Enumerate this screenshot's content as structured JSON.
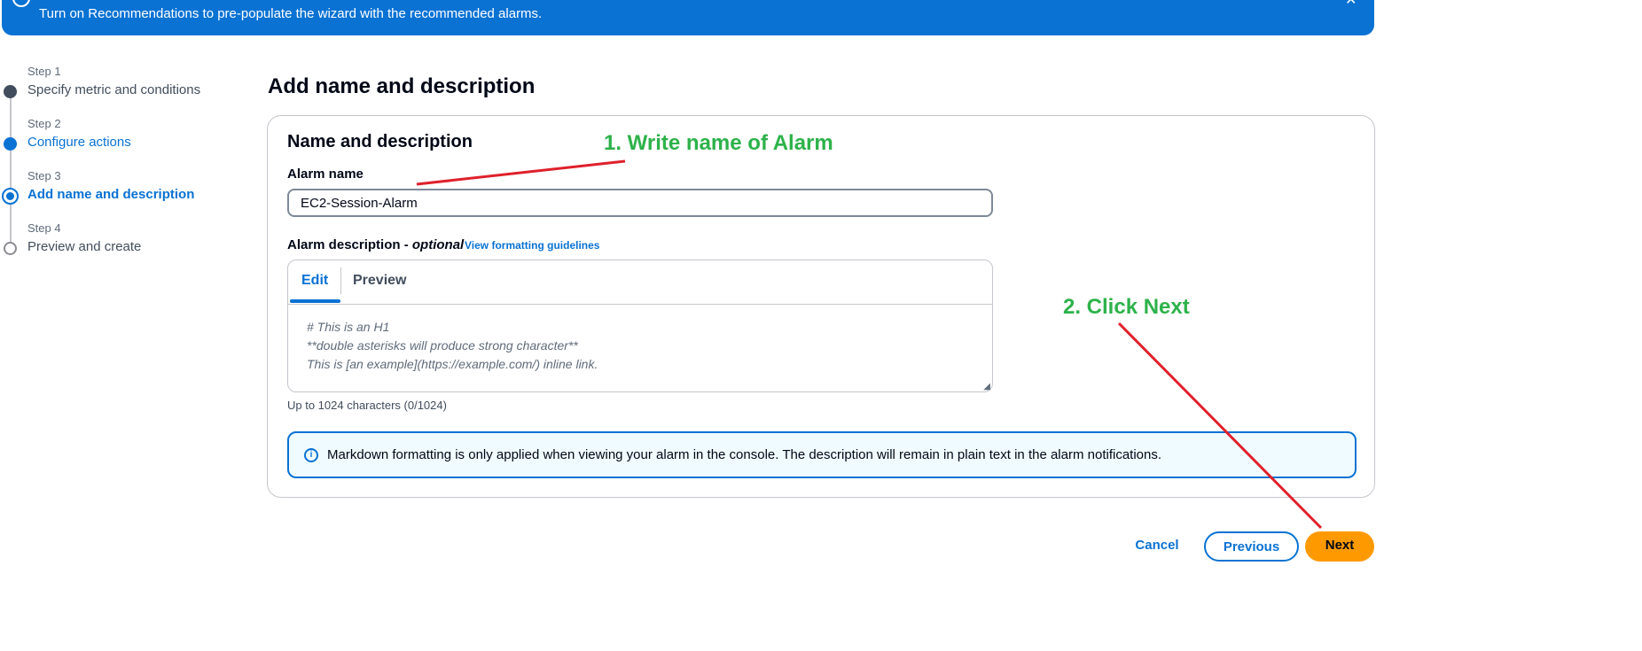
{
  "banner": {
    "text": "Turn on Recommendations to pre-populate the wizard with the recommended alarms.",
    "info_icon": "info-icon",
    "close_icon": "close-icon"
  },
  "steps": [
    {
      "label": "Step 1",
      "title": "Specify metric and conditions",
      "state": "completed"
    },
    {
      "label": "Step 2",
      "title": "Configure actions",
      "state": "link"
    },
    {
      "label": "Step 3",
      "title": "Add name and description",
      "state": "current"
    },
    {
      "label": "Step 4",
      "title": "Preview and create",
      "state": "pending"
    }
  ],
  "page": {
    "title": "Add name and description"
  },
  "card": {
    "title": "Name and description",
    "alarm_name_label": "Alarm name",
    "alarm_name_value": "EC2-Session-Alarm",
    "description_label": "Alarm description -",
    "description_optional": "optional",
    "formatting_link": "View formatting guidelines",
    "tabs": [
      {
        "label": "Edit",
        "selected": true
      },
      {
        "label": "Preview",
        "selected": false
      }
    ],
    "placeholder_lines": [
      "# This is an H1",
      "**double asterisks will produce strong character**",
      "This is [an example](https://example.com/) inline link."
    ],
    "char_count": "Up to 1024 characters (0/1024)",
    "info_alert": "Markdown formatting is only applied when viewing your alarm in the console. The description will remain in plain text in the alarm notifications.",
    "info_alert_icon": "info-circle-icon"
  },
  "annotations": {
    "one": "1. Write name of Alarm",
    "two": "2. Click Next",
    "color": "#2db24a",
    "arrow_color": "#e0202b"
  },
  "footer": {
    "cancel": "Cancel",
    "previous": "Previous",
    "next": "Next"
  },
  "colors": {
    "primary": "#0972d3",
    "next_button": "#ff9900",
    "text": "#000716"
  }
}
